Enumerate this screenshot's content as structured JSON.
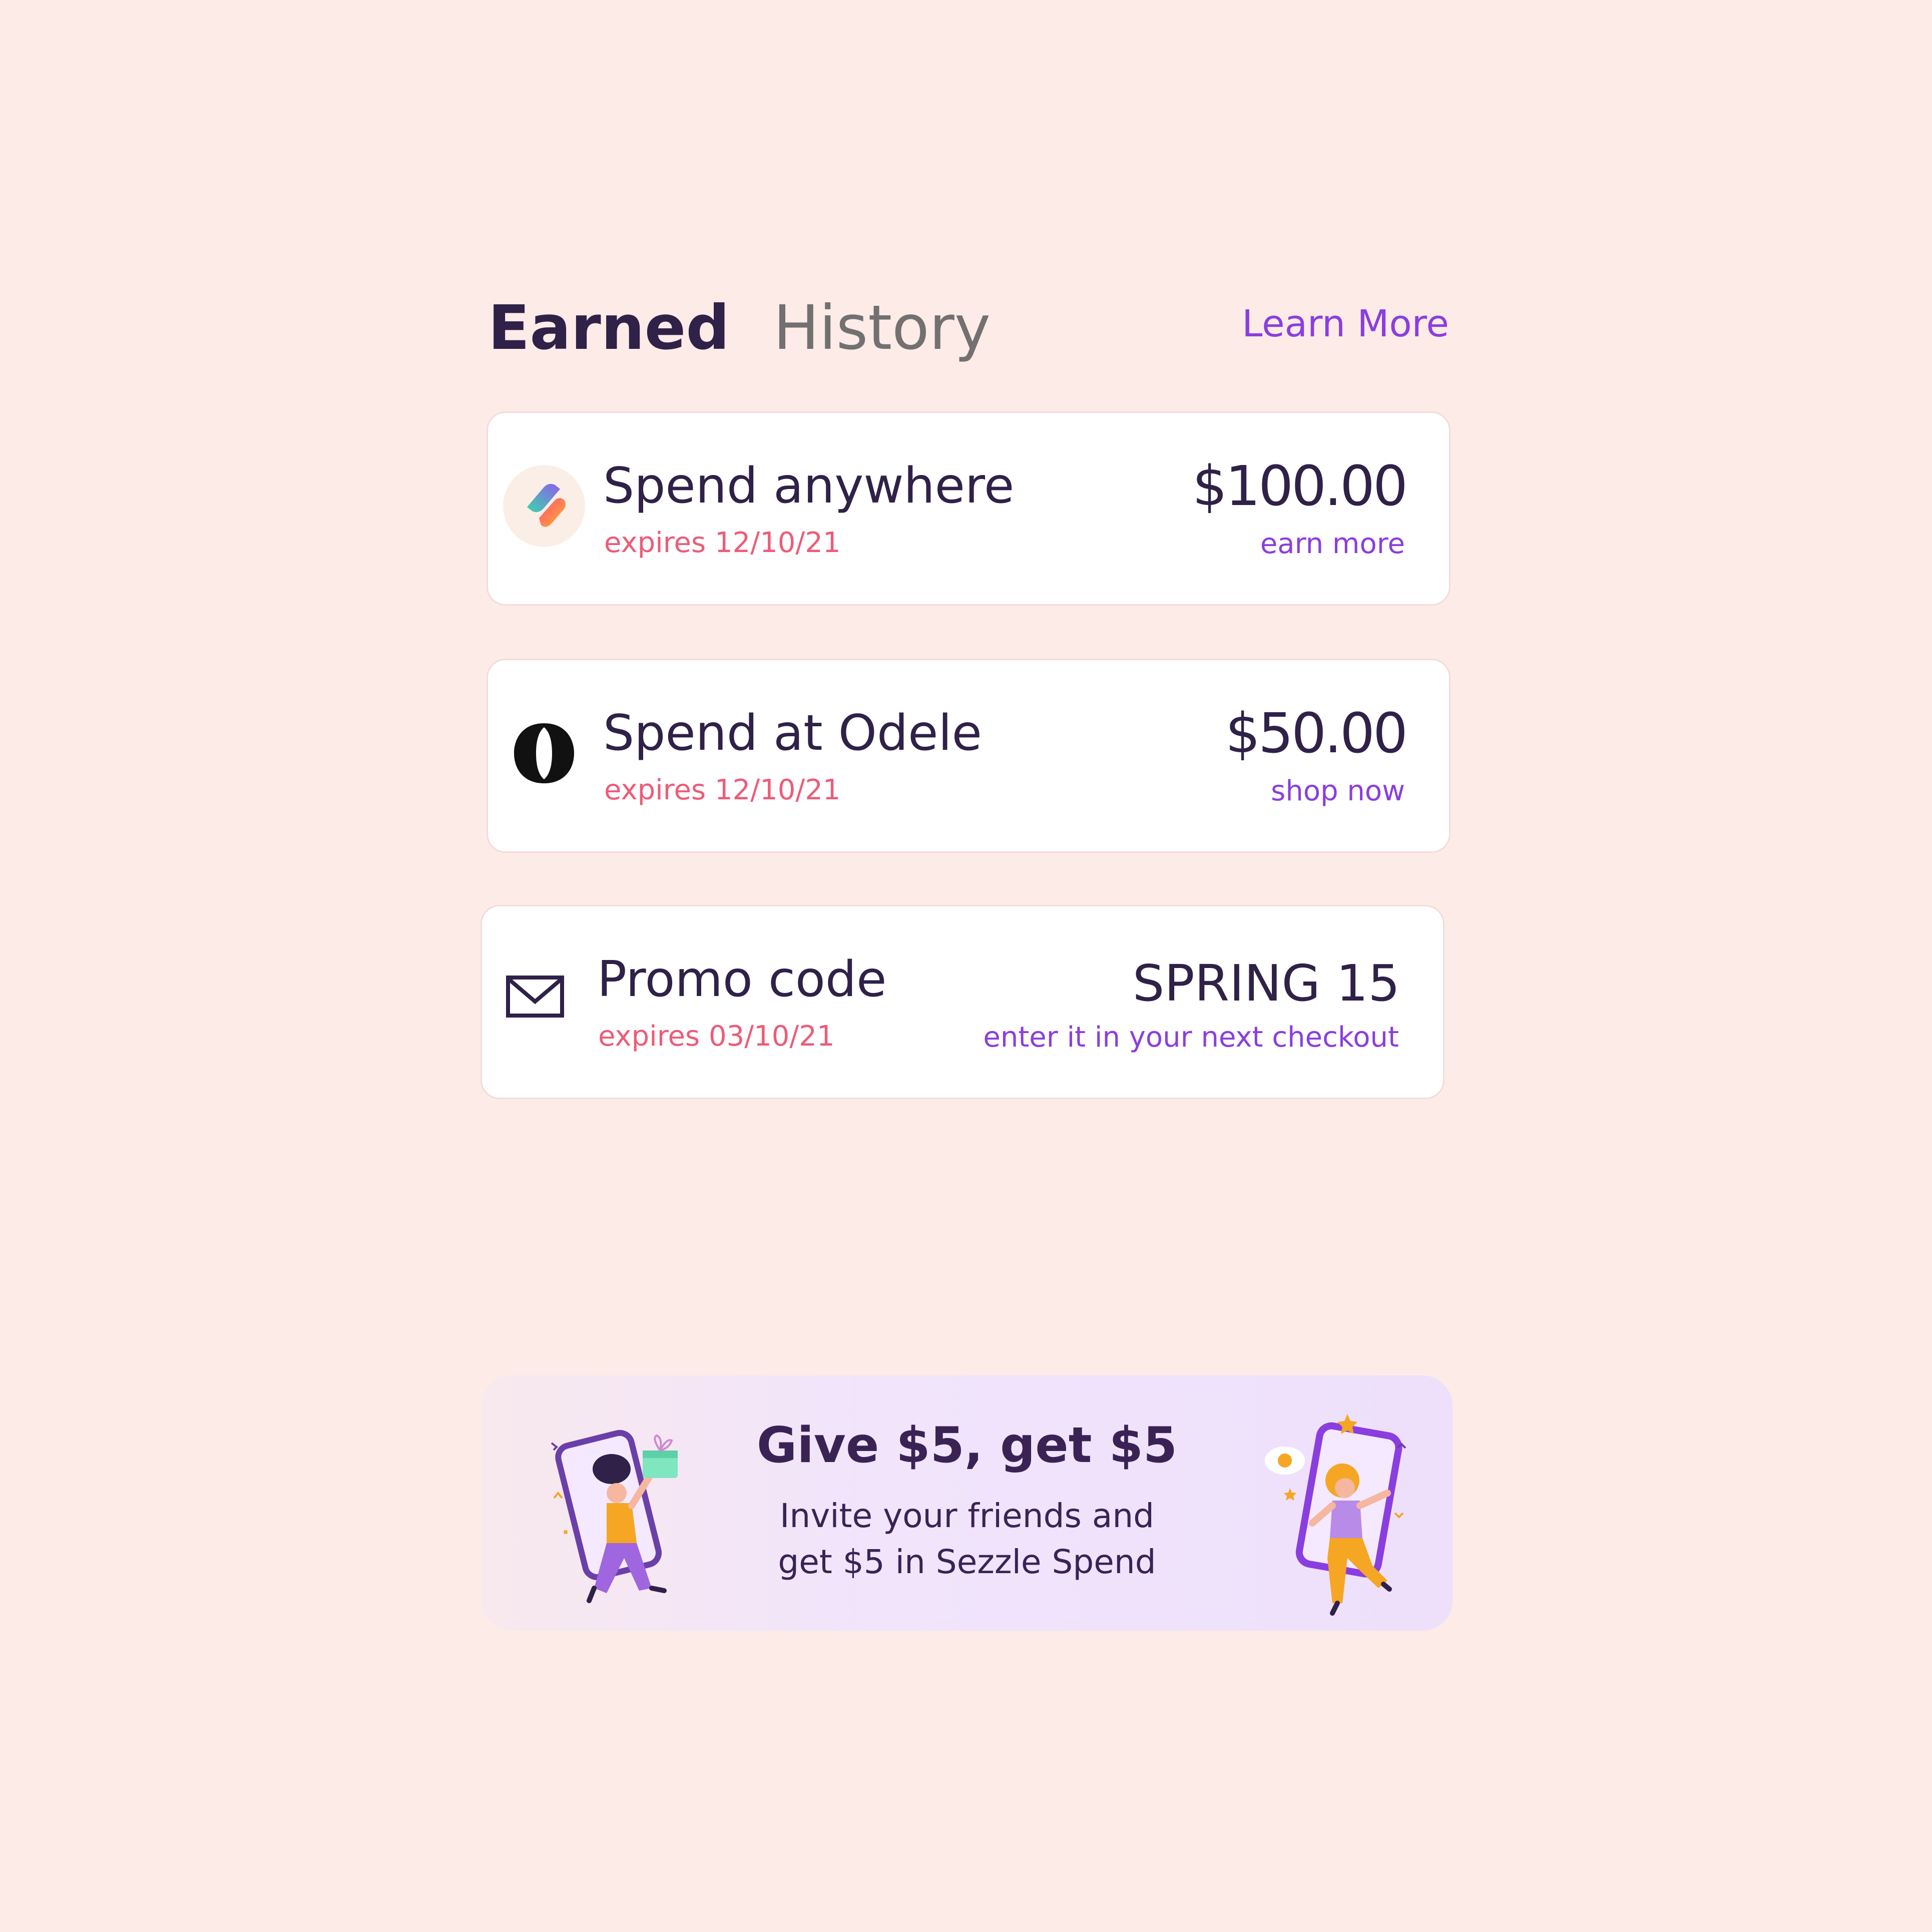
{
  "tabs": {
    "earned_label": "Earned",
    "history_label": "History",
    "learn_more_label": "Learn More"
  },
  "cards": [
    {
      "title": "Spend anywhere",
      "expires": "expires 12/10/21",
      "amount": "$100.00",
      "action": "earn more",
      "icon": "sezzle-logo-icon"
    },
    {
      "title": "Spend at Odele",
      "expires": "expires 12/10/21",
      "amount": "$50.00",
      "action": "shop now",
      "icon": "odele-logo-icon"
    },
    {
      "title": "Promo code",
      "expires": "expires 03/10/21",
      "amount": "SPRING 15",
      "action": "enter it in your next checkout",
      "icon": "envelope-icon"
    }
  ],
  "referral": {
    "title": "Give $5, get $5",
    "line1": "Invite your friends and",
    "line2": "get $5 in Sezzle Spend"
  },
  "colors": {
    "background": "#fdebe7",
    "text_primary": "#2f2148",
    "accent_purple": "#8a3ee0",
    "expires_pink": "#ec5c78",
    "tab_inactive": "#727070"
  }
}
